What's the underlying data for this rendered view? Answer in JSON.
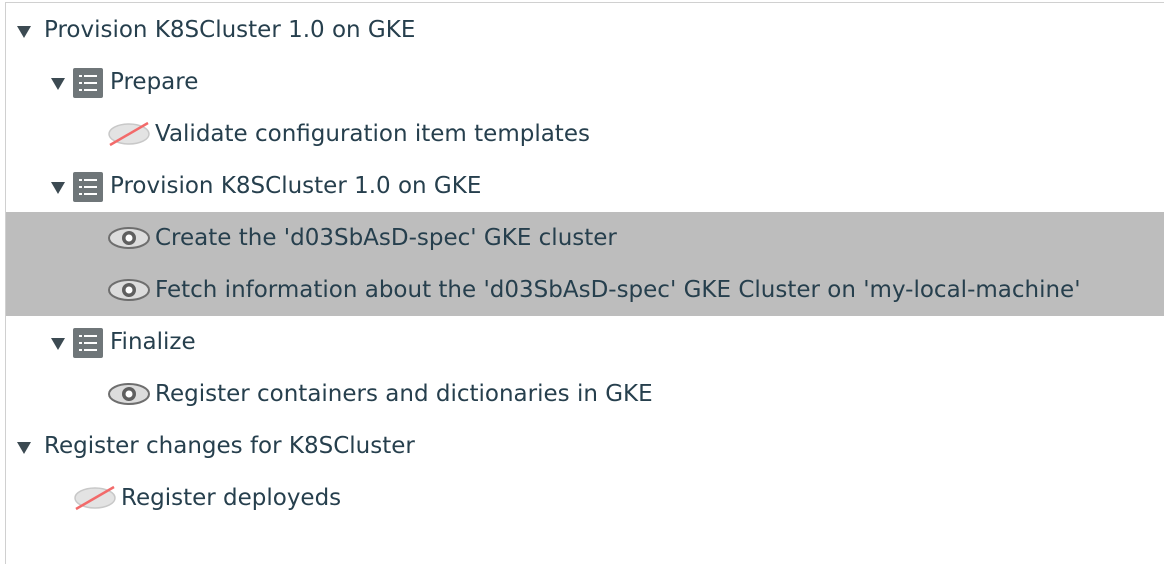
{
  "tree": {
    "items": [
      {
        "label": "Provision K8SCluster 1.0 on GKE",
        "type": "group",
        "expanded": true
      },
      {
        "label": "Prepare",
        "type": "step-list",
        "expanded": true
      },
      {
        "label": "Validate configuration item templates",
        "type": "step",
        "icon": "eye-hidden-icon"
      },
      {
        "label": "Provision K8SCluster 1.0 on GKE",
        "type": "step-list",
        "expanded": true
      },
      {
        "label": "Create the 'd03SbAsD-spec' GKE cluster",
        "type": "step",
        "icon": "eye-icon",
        "selected": true
      },
      {
        "label": "Fetch information about the 'd03SbAsD-spec' GKE Cluster on 'my-local-machine'",
        "type": "step",
        "icon": "eye-icon",
        "selected": true
      },
      {
        "label": "Finalize",
        "type": "step-list",
        "expanded": true
      },
      {
        "label": "Register containers and dictionaries in GKE",
        "type": "step",
        "icon": "eye-icon"
      },
      {
        "label": "Register changes for K8SCluster",
        "type": "group",
        "expanded": true
      },
      {
        "label": "Register deployeds",
        "type": "step",
        "icon": "eye-hidden-icon"
      }
    ]
  },
  "colors": {
    "selection": "#bdbdbd",
    "text": "#263f4d",
    "step_icon": "#6f7679"
  }
}
